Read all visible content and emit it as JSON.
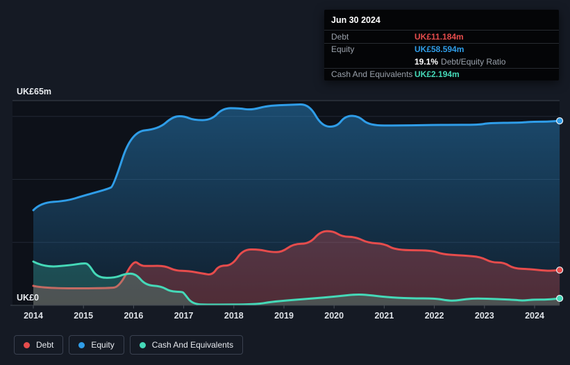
{
  "tooltip": {
    "date": "Jun 30 2024",
    "debt_label": "Debt",
    "debt_value": "UK£11.184m",
    "equity_label": "Equity",
    "equity_value": "UK£58.594m",
    "ratio_value": "19.1%",
    "ratio_label": "Debt/Equity Ratio",
    "cash_label": "Cash And Equivalents",
    "cash_value": "UK£2.194m"
  },
  "legend": {
    "items": [
      {
        "label": "Debt",
        "color": "#e64c4c"
      },
      {
        "label": "Equity",
        "color": "#2f9de8"
      },
      {
        "label": "Cash And Equivalents",
        "color": "#45d9b8"
      }
    ]
  },
  "colors": {
    "background": "#151a24",
    "plot_background": "#0d1119",
    "grid_strong": "#3a414d",
    "grid_minor": "#222834",
    "axis_line": "#3f4650",
    "tick": "#4a515b",
    "tick_label": "#dde1e6",
    "y_label": "#e9ecf0",
    "debt": "#e64c4c",
    "equity": "#2f9de8",
    "cash": "#45d9b8"
  },
  "chart_data": {
    "type": "area",
    "title": "",
    "xlabel": "",
    "ylabel": "",
    "xlim": [
      2014,
      2024.5
    ],
    "ylim": [
      0,
      65
    ],
    "grid": true,
    "legend_position": "bottom-left",
    "y_axis": {
      "top_label": "UK£65m",
      "bottom_label": "UK£0",
      "max": 65,
      "min": 0,
      "minor_gridlines": [
        20,
        40,
        60
      ]
    },
    "x_ticks": [
      2014,
      2015,
      2016,
      2017,
      2018,
      2019,
      2020,
      2021,
      2022,
      2023,
      2024
    ],
    "series": [
      {
        "name": "Debt",
        "color": "#e64c4c",
        "unit": "UK£m",
        "points": [
          [
            2014.0,
            6.2
          ],
          [
            2014.2,
            5.4
          ],
          [
            2015.5,
            5.4
          ],
          [
            2015.72,
            5.9
          ],
          [
            2016.0,
            14.5
          ],
          [
            2016.15,
            12.5
          ],
          [
            2016.3,
            12.5
          ],
          [
            2016.62,
            12.6
          ],
          [
            2016.83,
            11.0
          ],
          [
            2017.1,
            10.9
          ],
          [
            2017.38,
            10.1
          ],
          [
            2017.57,
            9.6
          ],
          [
            2017.7,
            12.6
          ],
          [
            2017.96,
            12.6
          ],
          [
            2018.18,
            17.7
          ],
          [
            2018.49,
            17.8
          ],
          [
            2018.74,
            16.9
          ],
          [
            2018.96,
            16.9
          ],
          [
            2019.19,
            19.5
          ],
          [
            2019.51,
            19.6
          ],
          [
            2019.73,
            23.5
          ],
          [
            2019.98,
            23.6
          ],
          [
            2020.16,
            21.8
          ],
          [
            2020.43,
            21.7
          ],
          [
            2020.68,
            19.8
          ],
          [
            2021.0,
            19.6
          ],
          [
            2021.23,
            17.5
          ],
          [
            2021.95,
            17.5
          ],
          [
            2022.16,
            16.2
          ],
          [
            2022.59,
            15.8
          ],
          [
            2022.92,
            15.4
          ],
          [
            2023.14,
            13.6
          ],
          [
            2023.39,
            13.6
          ],
          [
            2023.58,
            11.7
          ],
          [
            2023.92,
            11.5
          ],
          [
            2024.27,
            10.9
          ],
          [
            2024.5,
            11.184
          ]
        ]
      },
      {
        "name": "Equity",
        "color": "#2f9de8",
        "unit": "UK£m",
        "points": [
          [
            2014.0,
            30.2
          ],
          [
            2014.15,
            32.6
          ],
          [
            2014.65,
            33.1
          ],
          [
            2015.0,
            34.8
          ],
          [
            2015.5,
            37.0
          ],
          [
            2015.6,
            37.9
          ],
          [
            2015.95,
            55.1
          ],
          [
            2016.5,
            56.0
          ],
          [
            2016.78,
            59.9
          ],
          [
            2017.0,
            60.1
          ],
          [
            2017.2,
            58.8
          ],
          [
            2017.55,
            58.8
          ],
          [
            2017.78,
            62.6
          ],
          [
            2018.1,
            62.6
          ],
          [
            2018.35,
            62.0
          ],
          [
            2018.67,
            63.4
          ],
          [
            2019.15,
            63.7
          ],
          [
            2019.5,
            63.9
          ],
          [
            2019.75,
            56.9
          ],
          [
            2020.05,
            56.6
          ],
          [
            2020.22,
            60.1
          ],
          [
            2020.48,
            60.2
          ],
          [
            2020.7,
            57.1
          ],
          [
            2021.3,
            57.1
          ],
          [
            2022.2,
            57.3
          ],
          [
            2022.9,
            57.3
          ],
          [
            2023.07,
            57.9
          ],
          [
            2023.7,
            58.0
          ],
          [
            2023.95,
            58.3
          ],
          [
            2024.25,
            58.3
          ],
          [
            2024.5,
            58.594
          ]
        ]
      },
      {
        "name": "Cash And Equivalents",
        "color": "#45d9b8",
        "unit": "UK£m",
        "points": [
          [
            2014.0,
            13.9
          ],
          [
            2014.22,
            12.1
          ],
          [
            2014.72,
            12.7
          ],
          [
            2015.0,
            13.4
          ],
          [
            2015.1,
            13.2
          ],
          [
            2015.27,
            8.8
          ],
          [
            2015.62,
            8.7
          ],
          [
            2015.83,
            10.0
          ],
          [
            2016.04,
            10.1
          ],
          [
            2016.24,
            6.4
          ],
          [
            2016.55,
            6.1
          ],
          [
            2016.73,
            4.4
          ],
          [
            2016.96,
            4.3
          ],
          [
            2017.0,
            4.0
          ],
          [
            2017.17,
            0.4
          ],
          [
            2017.5,
            0.2
          ],
          [
            2018.46,
            0.3
          ],
          [
            2018.74,
            1.1
          ],
          [
            2019.11,
            1.6
          ],
          [
            2019.57,
            2.2
          ],
          [
            2020.02,
            2.8
          ],
          [
            2020.44,
            3.5
          ],
          [
            2020.68,
            3.3
          ],
          [
            2021.04,
            2.6
          ],
          [
            2021.51,
            2.2
          ],
          [
            2022.02,
            2.2
          ],
          [
            2022.28,
            1.5
          ],
          [
            2022.42,
            1.5
          ],
          [
            2022.64,
            2.0
          ],
          [
            2022.84,
            2.2
          ],
          [
            2023.25,
            2.0
          ],
          [
            2023.65,
            1.7
          ],
          [
            2023.76,
            1.5
          ],
          [
            2023.97,
            1.8
          ],
          [
            2024.27,
            1.8
          ],
          [
            2024.5,
            2.194
          ]
        ]
      }
    ]
  }
}
